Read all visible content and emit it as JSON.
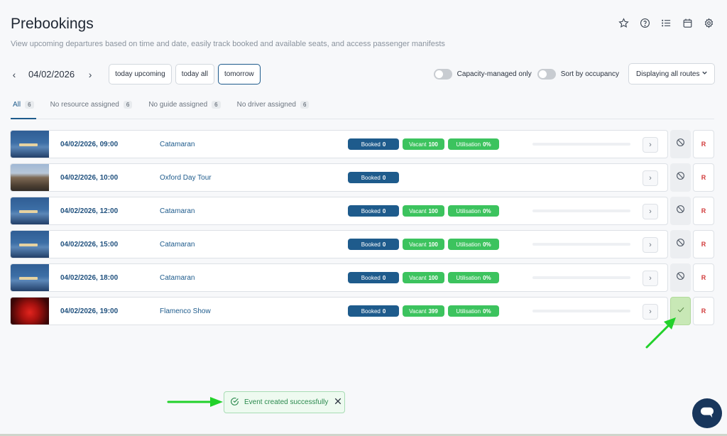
{
  "header": {
    "title": "Prebookings",
    "subtitle": "View upcoming departures based on time and date, easily track booked and available seats, and access passenger manifests"
  },
  "top_icons": [
    "star-icon",
    "help-icon",
    "list-icon",
    "calendar-icon",
    "gear-icon"
  ],
  "toolbar": {
    "date": "04/02/2026",
    "quick_filters": [
      {
        "label": "today upcoming",
        "active": false
      },
      {
        "label": "today all",
        "active": false
      },
      {
        "label": "tomorrow",
        "active": true
      }
    ],
    "capacity_toggle_label": "Capacity-managed only",
    "sort_toggle_label": "Sort by occupancy",
    "route_select_value": "Displaying all routes"
  },
  "tabs": [
    {
      "label": "All",
      "count": "6",
      "active": true
    },
    {
      "label": "No resource assigned",
      "count": "6",
      "active": false
    },
    {
      "label": "No guide assigned",
      "count": "6",
      "active": false
    },
    {
      "label": "No driver assigned",
      "count": "6",
      "active": false
    }
  ],
  "departures": [
    {
      "datetime": "04/02/2026, 09:00",
      "name": "Catamaran",
      "thumb": "boat",
      "booked_label": "Booked",
      "booked": "0",
      "vacant_label": "Vacant",
      "vacant": "100",
      "util_label": "Utilisation",
      "util": "0%",
      "status": "blocked",
      "r": "R"
    },
    {
      "datetime": "04/02/2026, 10:00",
      "name": "Oxford Day Tour",
      "thumb": "oxford",
      "booked_label": "Booked",
      "booked": "0",
      "vacant_label": "",
      "vacant": "",
      "util_label": "",
      "util": "",
      "status": "blocked",
      "r": "R"
    },
    {
      "datetime": "04/02/2026, 12:00",
      "name": "Catamaran",
      "thumb": "boat",
      "booked_label": "Booked",
      "booked": "0",
      "vacant_label": "Vacant",
      "vacant": "100",
      "util_label": "Utilisation",
      "util": "0%",
      "status": "blocked",
      "r": "R"
    },
    {
      "datetime": "04/02/2026, 15:00",
      "name": "Catamaran",
      "thumb": "boat",
      "booked_label": "Booked",
      "booked": "0",
      "vacant_label": "Vacant",
      "vacant": "100",
      "util_label": "Utilisation",
      "util": "0%",
      "status": "blocked",
      "r": "R"
    },
    {
      "datetime": "04/02/2026, 18:00",
      "name": "Catamaran",
      "thumb": "boat",
      "booked_label": "Booked",
      "booked": "0",
      "vacant_label": "Vacant",
      "vacant": "100",
      "util_label": "Utilisation",
      "util": "0%",
      "status": "blocked",
      "r": "R"
    },
    {
      "datetime": "04/02/2026, 19:00",
      "name": "Flamenco Show",
      "thumb": "flamenco",
      "booked_label": "Booked",
      "booked": "0",
      "vacant_label": "Vacant",
      "vacant": "399",
      "util_label": "Utilisation",
      "util": "0%",
      "status": "created",
      "r": "R"
    }
  ],
  "toast": {
    "message": "Event created successfully"
  },
  "colors": {
    "primary": "#1e5b8c",
    "success": "#3cc35e",
    "danger": "#d13b3b",
    "annotation": "#22d12a"
  }
}
